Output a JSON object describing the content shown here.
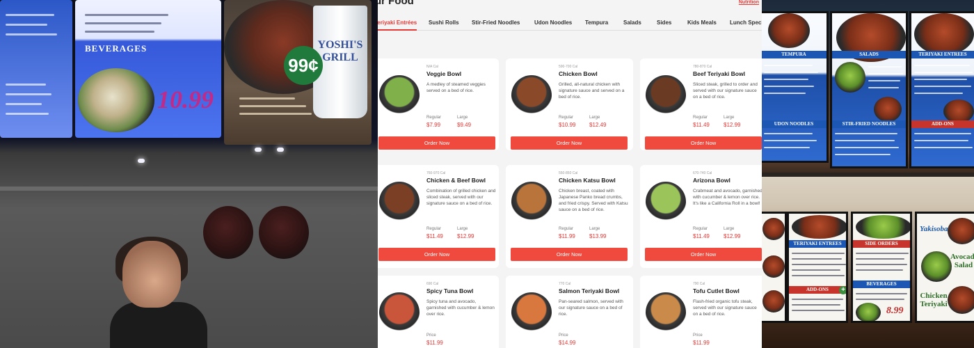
{
  "photo_left": {
    "board_header": "BEVERAGES",
    "promo_price": "10.99",
    "badge_price": "99¢",
    "cup_brand": "YOSHI'S GRILL"
  },
  "site": {
    "title_fragment": "ur Food",
    "nutrition_link": "Nutrition",
    "accent_color": "#e53935",
    "button_color": "#f04a3e",
    "tabs": [
      {
        "label": "Teriyaki Entrées",
        "active": true
      },
      {
        "label": "Sushi Rolls",
        "active": false
      },
      {
        "label": "Stir-Fried Noodles",
        "active": false
      },
      {
        "label": "Udon Noodles",
        "active": false
      },
      {
        "label": "Tempura",
        "active": false
      },
      {
        "label": "Salads",
        "active": false
      },
      {
        "label": "Sides",
        "active": false
      },
      {
        "label": "Kids Meals",
        "active": false
      },
      {
        "label": "Lunch Specials",
        "active": false
      }
    ],
    "order_label": "Order Now",
    "cards": [
      {
        "cal": "N/A Cal",
        "name": "Veggie Bowl",
        "desc": "A medley of steamed veggies served on a bed of rice.",
        "sizes": [
          {
            "label": "Regular",
            "price": "$7.99"
          },
          {
            "label": "Large",
            "price": "$9.49"
          }
        ],
        "food_color": "#7fb04a"
      },
      {
        "cal": "590-700 Cal",
        "name": "Chicken Bowl",
        "desc": "Grilled, all-natural chicken with signature sauce and served on a bed of rice.",
        "sizes": [
          {
            "label": "Regular",
            "price": "$10.99"
          },
          {
            "label": "Large",
            "price": "$12.49"
          }
        ],
        "food_color": "#8a4a2a"
      },
      {
        "cal": "780-870 Cal",
        "name": "Beef Teriyaki Bowl",
        "desc": "Sliced steak, grilled to order and served with our signature sauce on a bed of rice.",
        "sizes": [
          {
            "label": "Regular",
            "price": "$11.49"
          },
          {
            "label": "Large",
            "price": "$12.99"
          }
        ],
        "food_color": "#6b3a22"
      },
      {
        "cal": "760-970 Cal",
        "name": "Chicken & Beef Bowl",
        "desc": "Combination of grilled chicken and sliced steak, served with our signature sauce on a bed of rice.",
        "sizes": [
          {
            "label": "Regular",
            "price": "$11.49"
          },
          {
            "label": "Large",
            "price": "$12.99"
          }
        ],
        "food_color": "#7a3f24"
      },
      {
        "cal": "550-850 Cal",
        "name": "Chicken Katsu Bowl",
        "desc": "Chicken breast, coated with Japanese Panko bread crumbs, and fried crispy. Served with Katsu sauce on a bed of rice.",
        "sizes": [
          {
            "label": "Regular",
            "price": "$11.99"
          },
          {
            "label": "Large",
            "price": "$13.99"
          }
        ],
        "food_color": "#b8743a"
      },
      {
        "cal": "670-740 Cal",
        "name": "Arizona Bowl",
        "desc": "Crabmeat and avocado, garnished with cucumber & lemon over rice. It's like a California Roll in a bowl!",
        "sizes": [
          {
            "label": "Regular",
            "price": "$11.49"
          },
          {
            "label": "Large",
            "price": "$12.99"
          }
        ],
        "food_color": "#9bc45a"
      },
      {
        "cal": "690 Cal",
        "name": "Spicy Tuna Bowl",
        "desc": "Spicy tuna and avocado, garnished with cucumber & lemon over rice.",
        "sizes": [
          {
            "label": "Price",
            "price": "$11.99"
          }
        ],
        "food_color": "#c9553a"
      },
      {
        "cal": "770 Cal",
        "name": "Salmon Teriyaki Bowl",
        "desc": "Pan-seared salmon, served with our signature sauce on a bed of rice.",
        "sizes": [
          {
            "label": "Price",
            "price": "$14.99"
          }
        ],
        "food_color": "#d9783e"
      },
      {
        "cal": "790 Cal",
        "name": "Tofu Cutlet Bowl",
        "desc": "Flash-fried organic tofu steak, served with our signature sauce on a bed of rice.",
        "sizes": [
          {
            "label": "Price",
            "price": "$11.99"
          }
        ],
        "food_color": "#c98a4a"
      }
    ]
  },
  "photo_right": {
    "top_boards": [
      {
        "header": "TEMPURA"
      },
      {
        "header": "SALADS"
      },
      {
        "header": "TERIYAKI ENTREES"
      }
    ],
    "top_sub_headers": [
      "UDON NOODLES",
      "STIR-FRIED NOODLES",
      "ADD-ONS"
    ],
    "bottom_boards": [
      {
        "header": "TERIYAKI ENTREES"
      },
      {
        "header": "SIDE ORDERS"
      },
      {
        "header": "BEVERAGES"
      }
    ],
    "bottom_add_ons": "ADD-ONS",
    "bottom_price": "8.99",
    "yakisoba_label": "Yakisoba",
    "avocado_label": "Avocado Salad",
    "chicken_label": "Chicken Teriyaki"
  }
}
